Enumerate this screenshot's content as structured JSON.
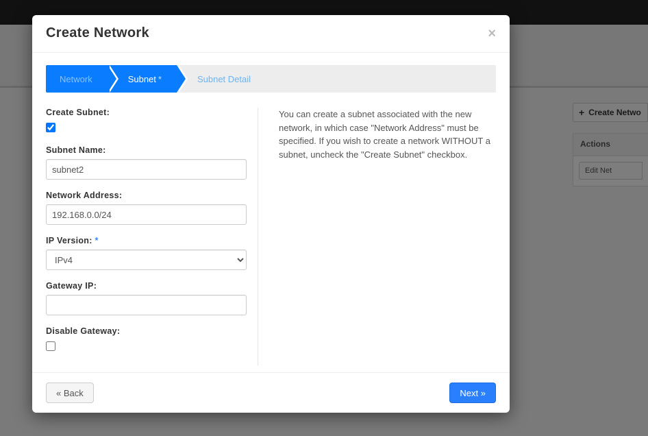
{
  "background": {
    "create_btn": "Create Netwo",
    "actions_header": "Actions",
    "edit_btn": "Edit Net"
  },
  "modal": {
    "title": "Create Network",
    "close": "×"
  },
  "wizard": {
    "step1": "Network",
    "step2": "Subnet",
    "step2_ast": "*",
    "step3": "Subnet Detail"
  },
  "form": {
    "create_subnet_label": "Create Subnet:",
    "create_subnet_checked": true,
    "subnet_name_label": "Subnet Name:",
    "subnet_name_value": "subnet2",
    "network_address_label": "Network Address:",
    "network_address_value": "192.168.0.0/24",
    "ip_version_label": "IP Version:",
    "ip_version_ast": "*",
    "ip_version_value": "IPv4",
    "gateway_ip_label": "Gateway IP:",
    "gateway_ip_value": "",
    "disable_gateway_label": "Disable Gateway:",
    "disable_gateway_checked": false
  },
  "help_text": "You can create a subnet associated with the new network, in which case \"Network Address\" must be specified. If you wish to create a network WITHOUT a subnet, uncheck the \"Create Subnet\" checkbox.",
  "footer": {
    "back": "« Back",
    "next": "Next »"
  }
}
